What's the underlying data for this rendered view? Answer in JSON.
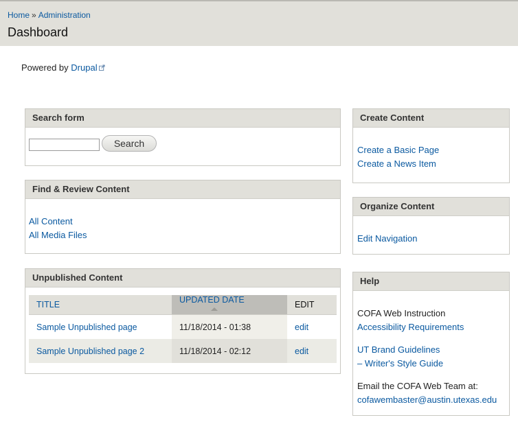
{
  "breadcrumb": {
    "home": "Home",
    "separator": "»",
    "admin": "Administration"
  },
  "page_title": "Dashboard",
  "powered": {
    "prefix": "Powered by",
    "link": "Drupal"
  },
  "search_block": {
    "title": "Search form",
    "input_value": "",
    "button": "Search"
  },
  "find_block": {
    "title": "Find & Review Content",
    "links": [
      "All Content",
      "All Media Files"
    ]
  },
  "unpublished_block": {
    "title": "Unpublished Content",
    "headers": {
      "title": "TITLE",
      "updated": "UPDATED DATE",
      "edit": "EDIT"
    },
    "rows": [
      {
        "title": "Sample Unpublished page",
        "date": "11/18/2014 - 01:38",
        "edit": "edit"
      },
      {
        "title": "Sample Unpublished page 2",
        "date": "11/18/2014 - 02:12",
        "edit": "edit"
      }
    ]
  },
  "create_block": {
    "title": "Create Content",
    "links": [
      "Create a Basic Page",
      "Create a News Item"
    ]
  },
  "organize_block": {
    "title": "Organize Content",
    "links": [
      "Edit Navigation"
    ]
  },
  "help_block": {
    "title": "Help",
    "text1": "COFA Web Instruction",
    "link1": "Accessibility Requirements",
    "link2": "UT Brand Guidelines",
    "link3": "– Writer's Style Guide",
    "email_label": "Email the COFA Web Team at:",
    "email": "cofawembaster@austin.utexas.edu"
  },
  "colors": {
    "link": "#0a59a0",
    "header_bg": "#e1e0da",
    "active_col": "#bebdb8"
  }
}
